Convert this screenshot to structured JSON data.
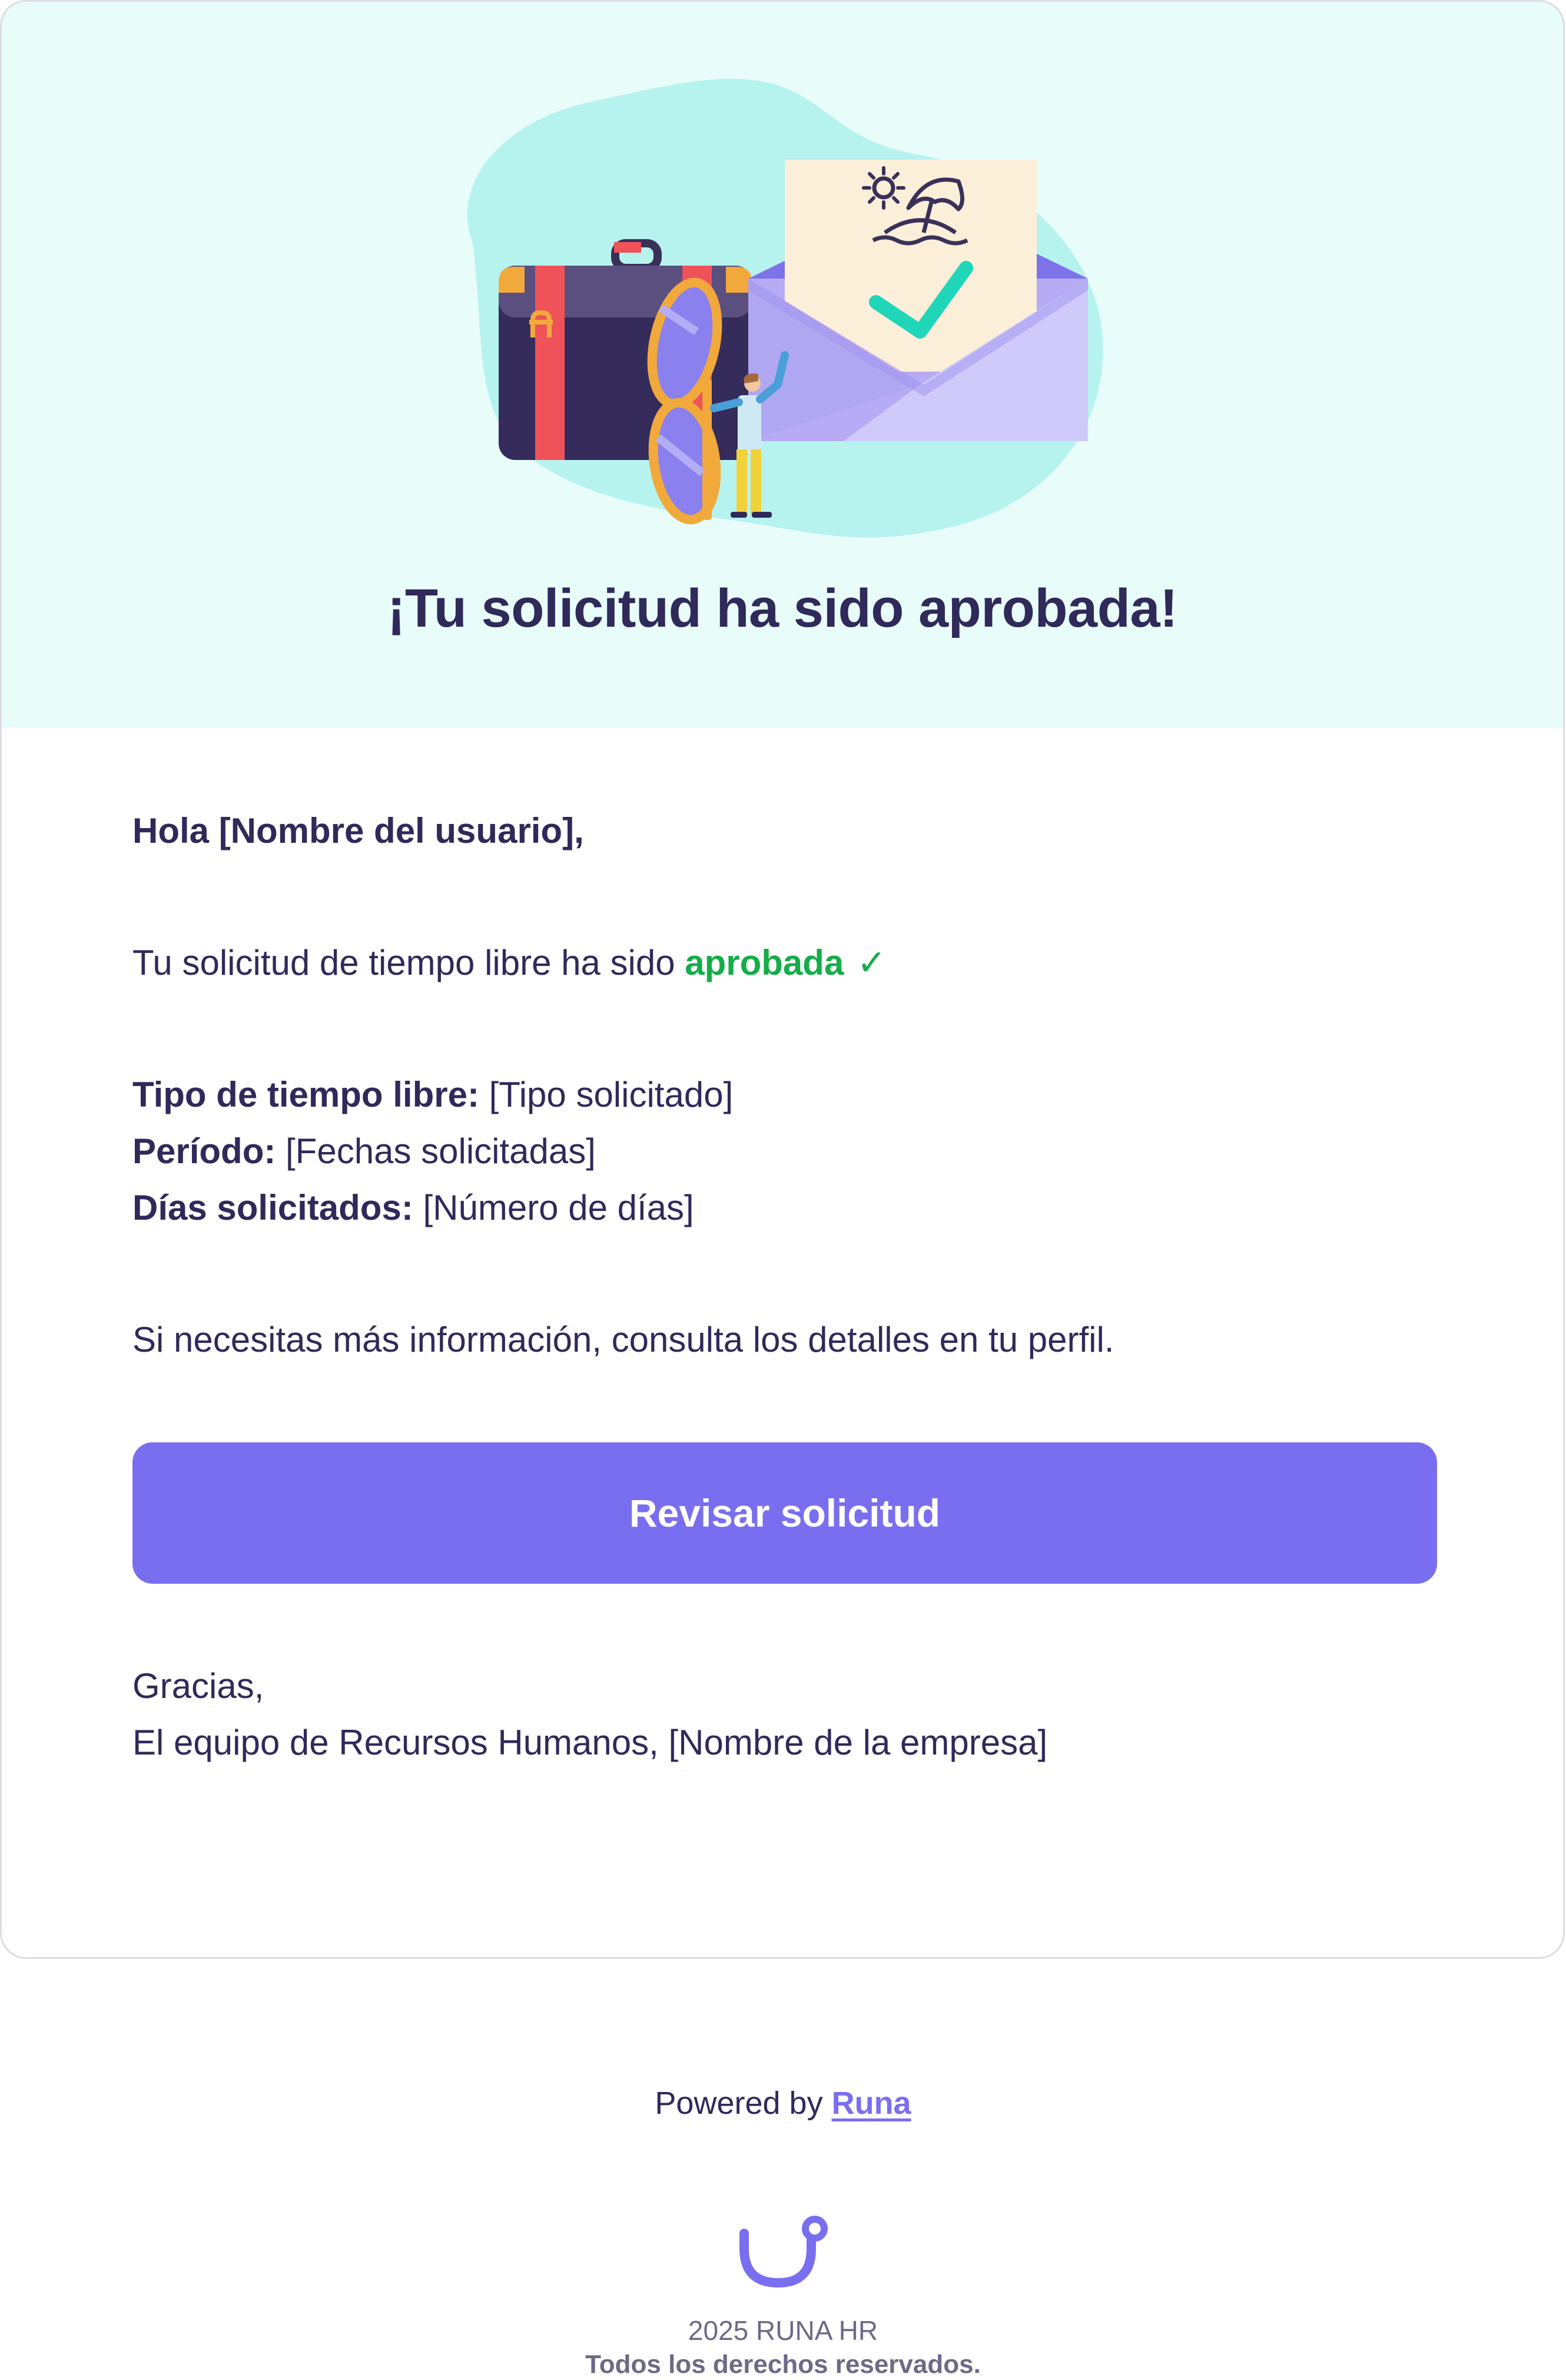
{
  "hero": {
    "title": "¡Tu solicitud ha sido aprobada!",
    "illustration": "suitcase-sunglasses-envelope-illustration"
  },
  "email": {
    "greeting": "Hola [Nombre del usuario],",
    "status_prefix": "Tu solicitud de tiempo libre ha sido",
    "status_word": "aprobada",
    "status_check": "✓",
    "details": [
      {
        "label": "Tipo de tiempo libre:",
        "value": "[Tipo solicitado]"
      },
      {
        "label": "Período:",
        "value": "[Fechas solicitadas]"
      },
      {
        "label": "Días solicitados:",
        "value": "[Número de días]"
      }
    ],
    "info": "Si necesitas más información, consulta los detalles en tu perfil.",
    "cta_label": "Revisar solicitud",
    "thanks": "Gracias,",
    "signature": "El equipo de Recursos Humanos, [Nombre de la empresa]"
  },
  "footer": {
    "powered_prefix": "Powered by",
    "powered_link": "Runa",
    "year": "2025 RUNA HR",
    "rights": "Todos los derechos reservados."
  },
  "colors": {
    "hero_bg": "#e8fcfa",
    "primary": "#7a6ef0",
    "text": "#2f2a5a",
    "approved": "#14ad48"
  }
}
